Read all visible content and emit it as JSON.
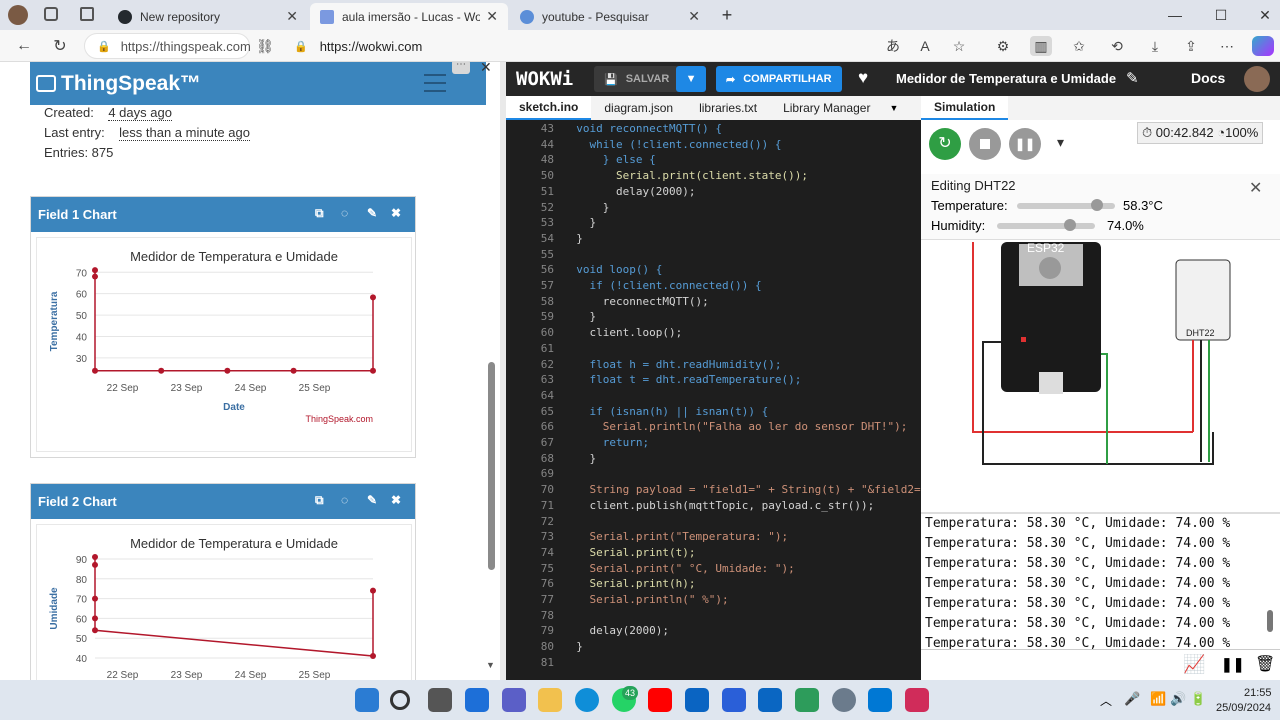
{
  "browser": {
    "tabs": [
      {
        "title": "New repository",
        "color": "#24292e"
      },
      {
        "title": "aula imersão - Lucas - Wokwi ESP",
        "color": "#6a8bd8"
      },
      {
        "title": "youtube - Pesquisar",
        "color": "#4a8bd8"
      }
    ],
    "url_left": "https://thingspeak.com",
    "url_right": "https://wokwi.com"
  },
  "thingspeak": {
    "logo": "ThingSpeak™",
    "created_label": "Created:",
    "created_value": "4 days ago",
    "last_entry_label": "Last entry:",
    "last_entry_value": "less than a minute ago",
    "entries": "Entries: 875",
    "field1": {
      "title": "Field 1 Chart"
    },
    "field2": {
      "title": "Field 2 Chart"
    }
  },
  "chart_data": [
    {
      "type": "line",
      "title": "Medidor de Temperatura e Umidade",
      "xlabel": "Date",
      "ylabel": "Temperatura",
      "categories": [
        "22 Sep",
        "23 Sep",
        "24 Sep",
        "25 Sep"
      ],
      "yticks": [
        30,
        40,
        50,
        60,
        70
      ],
      "ylim": [
        22,
        72
      ],
      "series": [
        {
          "points": [
            [
              0,
              71
            ],
            [
              0,
              68
            ],
            [
              0,
              24
            ],
            [
              1,
              24
            ],
            [
              2,
              24
            ],
            [
              3,
              24
            ],
            [
              4.2,
              24
            ],
            [
              4.2,
              58.3
            ]
          ]
        }
      ],
      "credit": "ThingSpeak.com",
      "color": "#b2172b"
    },
    {
      "type": "line",
      "title": "Medidor de Temperatura e Umidade",
      "xlabel": "",
      "ylabel": "Umidade",
      "categories": [
        "22 Sep",
        "23 Sep",
        "24 Sep",
        "25 Sep"
      ],
      "yticks": [
        40,
        50,
        60,
        70,
        80,
        90
      ],
      "ylim": [
        38,
        92
      ],
      "series": [
        {
          "points": [
            [
              0,
              91
            ],
            [
              0,
              87
            ],
            [
              0,
              70
            ],
            [
              0,
              60
            ],
            [
              0,
              54
            ],
            [
              4.2,
              41
            ],
            [
              4.2,
              74
            ]
          ]
        }
      ],
      "color": "#b2172b"
    }
  ],
  "wokwi": {
    "logo": "WOKWi",
    "save": "SALVAR",
    "share": "COMPARTILHAR",
    "project": "Medidor de Temperatura e Umidade",
    "docs": "Docs",
    "tabs": [
      "sketch.ino",
      "diagram.json",
      "libraries.txt",
      "Library Manager"
    ],
    "sim_tab": "Simulation",
    "timer": "00:42.842",
    "speed": "100%",
    "editing": "Editing DHT22",
    "temp_label": "Temperature:",
    "temp_value": "58.3°C",
    "temp_level": 0.82,
    "hum_label": "Humidity:",
    "hum_value": "74.0%",
    "hum_level": 0.74,
    "board_label": "ESP32",
    "sensor_label": "DHT22",
    "code": [
      {
        "n": "43",
        "t": "  void reconnectMQTT() {"
      },
      {
        "n": "44",
        "t": "    while (!client.connected()) {"
      },
      {
        "n": "48",
        "t": "      } else {"
      },
      {
        "n": "50",
        "t": "        Serial.print(client.state());"
      },
      {
        "n": "51",
        "t": "        delay(2000);"
      },
      {
        "n": "52",
        "t": "      }"
      },
      {
        "n": "53",
        "t": "    }"
      },
      {
        "n": "54",
        "t": "  }"
      },
      {
        "n": "55",
        "t": ""
      },
      {
        "n": "56",
        "t": "  void loop() {"
      },
      {
        "n": "57",
        "t": "    if (!client.connected()) {"
      },
      {
        "n": "58",
        "t": "      reconnectMQTT();"
      },
      {
        "n": "59",
        "t": "    }"
      },
      {
        "n": "60",
        "t": "    client.loop();"
      },
      {
        "n": "61",
        "t": ""
      },
      {
        "n": "62",
        "t": "    float h = dht.readHumidity();"
      },
      {
        "n": "63",
        "t": "    float t = dht.readTemperature();"
      },
      {
        "n": "64",
        "t": ""
      },
      {
        "n": "65",
        "t": "    if (isnan(h) || isnan(t)) {"
      },
      {
        "n": "66",
        "t": "      Serial.println(\"Falha ao ler do sensor DHT!\");"
      },
      {
        "n": "67",
        "t": "      return;"
      },
      {
        "n": "68",
        "t": "    }"
      },
      {
        "n": "69",
        "t": ""
      },
      {
        "n": "70",
        "t": "    String payload = \"field1=\" + String(t) + \"&field2=\""
      },
      {
        "n": "71",
        "t": "    client.publish(mqttTopic, payload.c_str());"
      },
      {
        "n": "72",
        "t": ""
      },
      {
        "n": "73",
        "t": "    Serial.print(\"Temperatura: \");"
      },
      {
        "n": "74",
        "t": "    Serial.print(t);"
      },
      {
        "n": "75",
        "t": "    Serial.print(\" °C, Umidade: \");"
      },
      {
        "n": "76",
        "t": "    Serial.print(h);"
      },
      {
        "n": "77",
        "t": "    Serial.println(\" %\");"
      },
      {
        "n": "78",
        "t": ""
      },
      {
        "n": "79",
        "t": "    delay(2000);"
      },
      {
        "n": "80",
        "t": "  }"
      },
      {
        "n": "81",
        "t": ""
      }
    ],
    "serial": [
      "Temperatura: 58.30 °C, Umidade: 74.00 %",
      "Temperatura: 58.30 °C, Umidade: 74.00 %",
      "Temperatura: 58.30 °C, Umidade: 74.00 %",
      "Temperatura: 58.30 °C, Umidade: 74.00 %",
      "Temperatura: 58.30 °C, Umidade: 74.00 %",
      "Temperatura: 58.30 °C, Umidade: 74.00 %",
      "Temperatura: 58.30 °C, Umidade: 74.00 %"
    ]
  },
  "taskbar": {
    "time": "21:55",
    "date": "25/09/2024",
    "whatsapp_badge": "43"
  }
}
